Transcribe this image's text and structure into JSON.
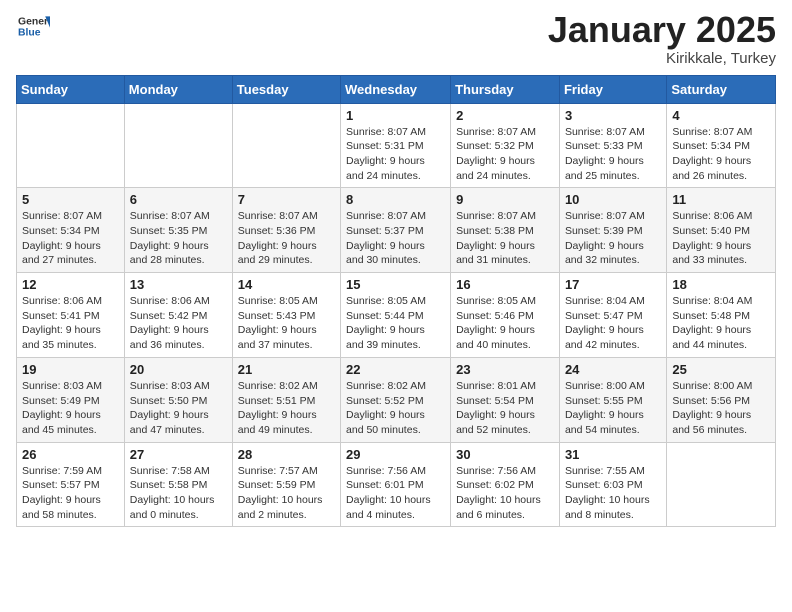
{
  "logo": {
    "general": "General",
    "blue": "Blue"
  },
  "header": {
    "month": "January 2025",
    "location": "Kirikkale, Turkey"
  },
  "weekdays": [
    "Sunday",
    "Monday",
    "Tuesday",
    "Wednesday",
    "Thursday",
    "Friday",
    "Saturday"
  ],
  "weeks": [
    [
      {
        "day": "",
        "sunrise": "",
        "sunset": "",
        "daylight": ""
      },
      {
        "day": "",
        "sunrise": "",
        "sunset": "",
        "daylight": ""
      },
      {
        "day": "",
        "sunrise": "",
        "sunset": "",
        "daylight": ""
      },
      {
        "day": "1",
        "sunrise": "Sunrise: 8:07 AM",
        "sunset": "Sunset: 5:31 PM",
        "daylight": "Daylight: 9 hours and 24 minutes."
      },
      {
        "day": "2",
        "sunrise": "Sunrise: 8:07 AM",
        "sunset": "Sunset: 5:32 PM",
        "daylight": "Daylight: 9 hours and 24 minutes."
      },
      {
        "day": "3",
        "sunrise": "Sunrise: 8:07 AM",
        "sunset": "Sunset: 5:33 PM",
        "daylight": "Daylight: 9 hours and 25 minutes."
      },
      {
        "day": "4",
        "sunrise": "Sunrise: 8:07 AM",
        "sunset": "Sunset: 5:34 PM",
        "daylight": "Daylight: 9 hours and 26 minutes."
      }
    ],
    [
      {
        "day": "5",
        "sunrise": "Sunrise: 8:07 AM",
        "sunset": "Sunset: 5:34 PM",
        "daylight": "Daylight: 9 hours and 27 minutes."
      },
      {
        "day": "6",
        "sunrise": "Sunrise: 8:07 AM",
        "sunset": "Sunset: 5:35 PM",
        "daylight": "Daylight: 9 hours and 28 minutes."
      },
      {
        "day": "7",
        "sunrise": "Sunrise: 8:07 AM",
        "sunset": "Sunset: 5:36 PM",
        "daylight": "Daylight: 9 hours and 29 minutes."
      },
      {
        "day": "8",
        "sunrise": "Sunrise: 8:07 AM",
        "sunset": "Sunset: 5:37 PM",
        "daylight": "Daylight: 9 hours and 30 minutes."
      },
      {
        "day": "9",
        "sunrise": "Sunrise: 8:07 AM",
        "sunset": "Sunset: 5:38 PM",
        "daylight": "Daylight: 9 hours and 31 minutes."
      },
      {
        "day": "10",
        "sunrise": "Sunrise: 8:07 AM",
        "sunset": "Sunset: 5:39 PM",
        "daylight": "Daylight: 9 hours and 32 minutes."
      },
      {
        "day": "11",
        "sunrise": "Sunrise: 8:06 AM",
        "sunset": "Sunset: 5:40 PM",
        "daylight": "Daylight: 9 hours and 33 minutes."
      }
    ],
    [
      {
        "day": "12",
        "sunrise": "Sunrise: 8:06 AM",
        "sunset": "Sunset: 5:41 PM",
        "daylight": "Daylight: 9 hours and 35 minutes."
      },
      {
        "day": "13",
        "sunrise": "Sunrise: 8:06 AM",
        "sunset": "Sunset: 5:42 PM",
        "daylight": "Daylight: 9 hours and 36 minutes."
      },
      {
        "day": "14",
        "sunrise": "Sunrise: 8:05 AM",
        "sunset": "Sunset: 5:43 PM",
        "daylight": "Daylight: 9 hours and 37 minutes."
      },
      {
        "day": "15",
        "sunrise": "Sunrise: 8:05 AM",
        "sunset": "Sunset: 5:44 PM",
        "daylight": "Daylight: 9 hours and 39 minutes."
      },
      {
        "day": "16",
        "sunrise": "Sunrise: 8:05 AM",
        "sunset": "Sunset: 5:46 PM",
        "daylight": "Daylight: 9 hours and 40 minutes."
      },
      {
        "day": "17",
        "sunrise": "Sunrise: 8:04 AM",
        "sunset": "Sunset: 5:47 PM",
        "daylight": "Daylight: 9 hours and 42 minutes."
      },
      {
        "day": "18",
        "sunrise": "Sunrise: 8:04 AM",
        "sunset": "Sunset: 5:48 PM",
        "daylight": "Daylight: 9 hours and 44 minutes."
      }
    ],
    [
      {
        "day": "19",
        "sunrise": "Sunrise: 8:03 AM",
        "sunset": "Sunset: 5:49 PM",
        "daylight": "Daylight: 9 hours and 45 minutes."
      },
      {
        "day": "20",
        "sunrise": "Sunrise: 8:03 AM",
        "sunset": "Sunset: 5:50 PM",
        "daylight": "Daylight: 9 hours and 47 minutes."
      },
      {
        "day": "21",
        "sunrise": "Sunrise: 8:02 AM",
        "sunset": "Sunset: 5:51 PM",
        "daylight": "Daylight: 9 hours and 49 minutes."
      },
      {
        "day": "22",
        "sunrise": "Sunrise: 8:02 AM",
        "sunset": "Sunset: 5:52 PM",
        "daylight": "Daylight: 9 hours and 50 minutes."
      },
      {
        "day": "23",
        "sunrise": "Sunrise: 8:01 AM",
        "sunset": "Sunset: 5:54 PM",
        "daylight": "Daylight: 9 hours and 52 minutes."
      },
      {
        "day": "24",
        "sunrise": "Sunrise: 8:00 AM",
        "sunset": "Sunset: 5:55 PM",
        "daylight": "Daylight: 9 hours and 54 minutes."
      },
      {
        "day": "25",
        "sunrise": "Sunrise: 8:00 AM",
        "sunset": "Sunset: 5:56 PM",
        "daylight": "Daylight: 9 hours and 56 minutes."
      }
    ],
    [
      {
        "day": "26",
        "sunrise": "Sunrise: 7:59 AM",
        "sunset": "Sunset: 5:57 PM",
        "daylight": "Daylight: 9 hours and 58 minutes."
      },
      {
        "day": "27",
        "sunrise": "Sunrise: 7:58 AM",
        "sunset": "Sunset: 5:58 PM",
        "daylight": "Daylight: 10 hours and 0 minutes."
      },
      {
        "day": "28",
        "sunrise": "Sunrise: 7:57 AM",
        "sunset": "Sunset: 5:59 PM",
        "daylight": "Daylight: 10 hours and 2 minutes."
      },
      {
        "day": "29",
        "sunrise": "Sunrise: 7:56 AM",
        "sunset": "Sunset: 6:01 PM",
        "daylight": "Daylight: 10 hours and 4 minutes."
      },
      {
        "day": "30",
        "sunrise": "Sunrise: 7:56 AM",
        "sunset": "Sunset: 6:02 PM",
        "daylight": "Daylight: 10 hours and 6 minutes."
      },
      {
        "day": "31",
        "sunrise": "Sunrise: 7:55 AM",
        "sunset": "Sunset: 6:03 PM",
        "daylight": "Daylight: 10 hours and 8 minutes."
      },
      {
        "day": "",
        "sunrise": "",
        "sunset": "",
        "daylight": ""
      }
    ]
  ]
}
